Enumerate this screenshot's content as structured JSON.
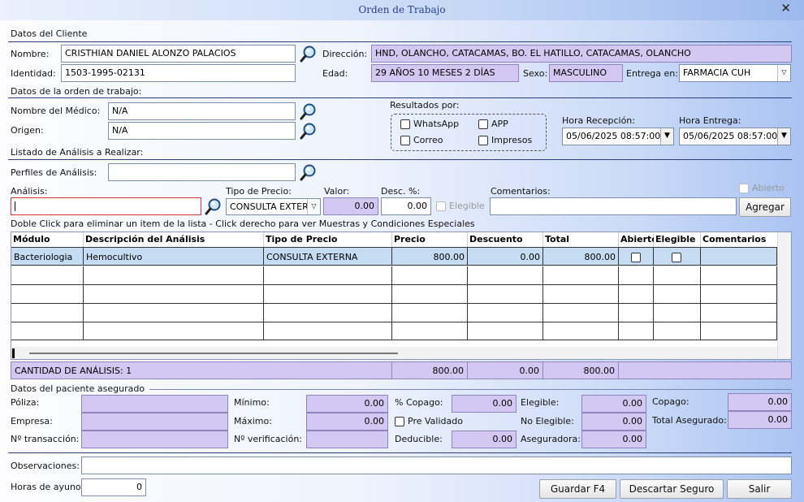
{
  "window": {
    "title": "Orden de Trabajo",
    "close": "✕"
  },
  "client": {
    "section": "Datos del Cliente",
    "name_label": "Nombre:",
    "name": "CRISTHIAN DANIEL ALONZO PALACIOS",
    "address_label": "Dirección:",
    "address": "HND, OLANCHO, CATACAMAS, BO. EL HATILLO, CATACAMAS, OLANCHO",
    "id_label": "Identidad:",
    "id": "1503-1995-02131",
    "age_label": "Edad:",
    "age": "29 AÑOS 10 MESES 2 DÍAS",
    "sex_label": "Sexo:",
    "sex": "MASCULINO",
    "delivery_label": "Entrega en:",
    "delivery": "FARMACIA CUH"
  },
  "order": {
    "section": "Datos de la orden de trabajo:",
    "doctor_label": "Nombre del Médico:",
    "doctor": "N/A",
    "origin_label": "Origen:",
    "origin": "N/A",
    "results_label": "Resultados por:",
    "whatsapp": "WhatsApp",
    "app": "APP",
    "correo": "Correo",
    "impresos": "Impresos",
    "reception_label": "Hora Recepción:",
    "reception": "05/06/2025 08:57:00",
    "delivery_time_label": "Hora Entrega:",
    "delivery_time": "05/06/2025 08:57:00"
  },
  "analysis": {
    "section": "Listado de Análisis a Realizar:",
    "profiles_label": "Perfiles de Análisis:",
    "analysis_label": "Análisis:",
    "price_type_label": "Tipo de Precio:",
    "price_type": "CONSULTA EXTERNA",
    "value_label": "Valor:",
    "value": "0.00",
    "disc_label": "Desc. %:",
    "disc": "0.00",
    "eligible": "Elegible",
    "comments_label": "Comentarios:",
    "open": "Abierto",
    "add_button": "Agregar",
    "hint": "Doble Click para eliminar un item de la lista - Click derecho para ver Muestras y Condiciones Especiales"
  },
  "grid": {
    "columns": [
      "Módulo",
      "Descripción del Análisis",
      "Tipo de Precio",
      "Precio",
      "Descuento",
      "Total",
      "Abierto",
      "Elegible",
      "Comentarios"
    ],
    "rows": [
      {
        "modulo": "Bacteriologia",
        "descripcion": "Hemocultivo",
        "tipo": "CONSULTA EXTERNA",
        "precio": "800.00",
        "descuento": "0.00",
        "total": "800.00",
        "comentarios": ""
      }
    ]
  },
  "summary": {
    "count": "CANTIDAD DE ANÁLISIS: 1",
    "price": "800.00",
    "discount": "0.00",
    "total": "800.00"
  },
  "insured": {
    "section": "Datos del paciente asegurado",
    "poliza": "Póliza:",
    "empresa": "Empresa:",
    "transaccion": "Nº transacción:",
    "minimo_label": "Mínimo:",
    "minimo": "0.00",
    "maximo_label": "Máximo:",
    "maximo": "0.00",
    "verificacion": "Nº verificación:",
    "copago_pct_label": "% Copago:",
    "copago_pct": "0.00",
    "pre_validado": "Pre Validado",
    "deducible_label": "Deducible:",
    "deducible": "0.00",
    "elegible_label": "Elegible:",
    "elegible": "0.00",
    "no_elegible_label": "No Elegible:",
    "no_elegible": "0.00",
    "aseguradora_label": "Aseguradora:",
    "aseguradora": "0.00",
    "copago_label": "Copago:",
    "copago": "0.00",
    "total_asegurado_label": "Total Asegurado:",
    "total_asegurado": "0.00"
  },
  "footer": {
    "obs_label": "Observaciones:",
    "fast_label": "Horas de ayuno:",
    "fast": "0",
    "save": "Guardar F4",
    "discard": "Descartar Seguro",
    "exit": "Salir"
  }
}
